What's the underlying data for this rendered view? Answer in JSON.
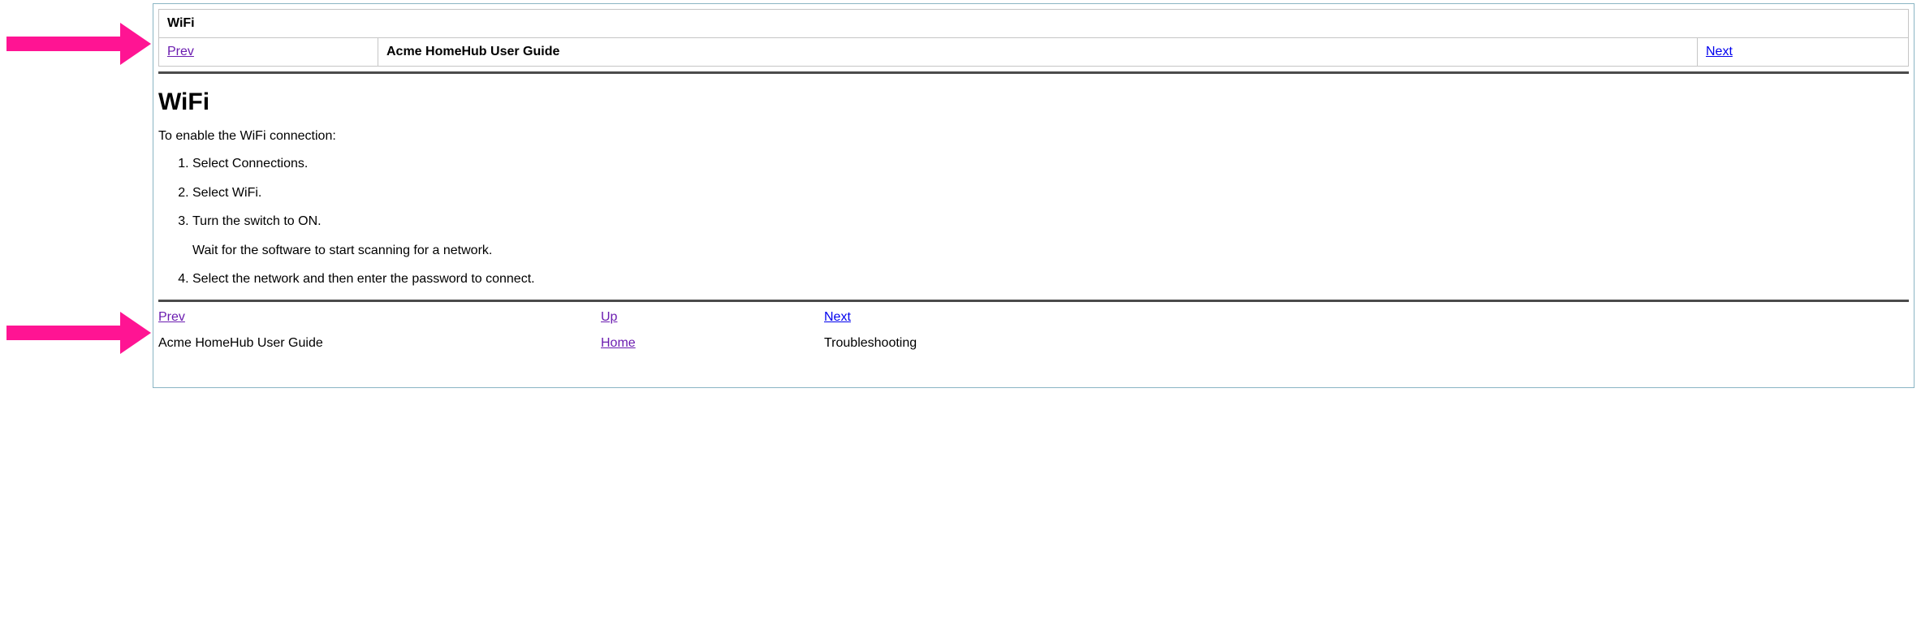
{
  "header": {
    "title": "WiFi",
    "prev_label": "Prev",
    "center_label": "Acme HomeHub User Guide",
    "next_label": "Next"
  },
  "content": {
    "heading": "WiFi",
    "intro": "To enable the WiFi connection:",
    "steps": [
      {
        "text": "Select Connections."
      },
      {
        "text": "Select WiFi."
      },
      {
        "text": "Turn the switch to ON.",
        "sub": "Wait for the software to start scanning for a network."
      },
      {
        "text": "Select the network and then enter the password to connect."
      }
    ]
  },
  "footer": {
    "prev_label": "Prev",
    "up_label": "Up",
    "next_label": "Next",
    "prev_title": "Acme HomeHub User Guide",
    "home_label": "Home",
    "next_title": "Troubleshooting"
  }
}
